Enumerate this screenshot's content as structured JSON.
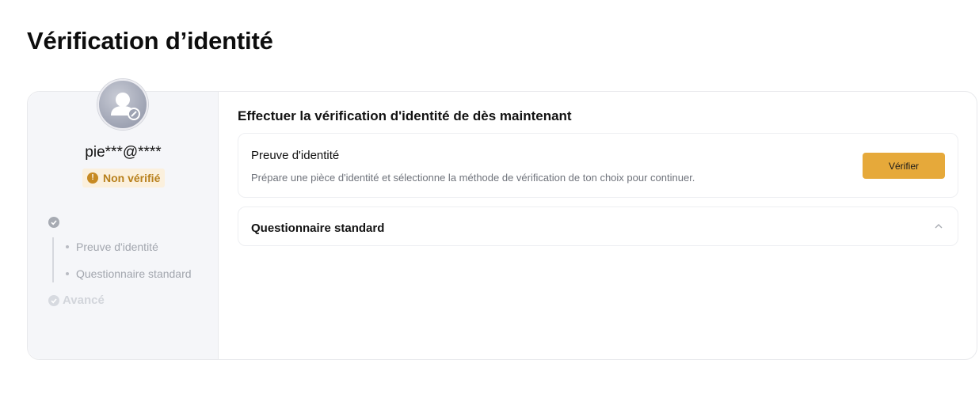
{
  "page": {
    "title": "Vérification d’identité"
  },
  "sidebar": {
    "username": "pie***@****",
    "status": {
      "label": "Non vérifié",
      "icon": "warning-icon",
      "color": "#b8801c"
    },
    "steps": [
      {
        "label": "",
        "state": "done",
        "icon": "check-circle-icon"
      },
      {
        "label": "Preuve d'identité",
        "state": "sub"
      },
      {
        "label": "Questionnaire standard",
        "state": "sub"
      },
      {
        "label": "Avancé",
        "state": "pending",
        "icon": "check-circle-icon"
      }
    ]
  },
  "main": {
    "title": "Effectuer la vérification d'identité de dès maintenant",
    "identity": {
      "heading": "Preuve d'identité",
      "description": "Prépare une pièce d'identité et sélectionne la méthode de vérification de ton choix pour continuer.",
      "button_label": "Vérifier",
      "button_color": "#e6a93a"
    },
    "questionnaire": {
      "heading": "Questionnaire standard",
      "expand_icon": "chevron-up-icon"
    }
  }
}
